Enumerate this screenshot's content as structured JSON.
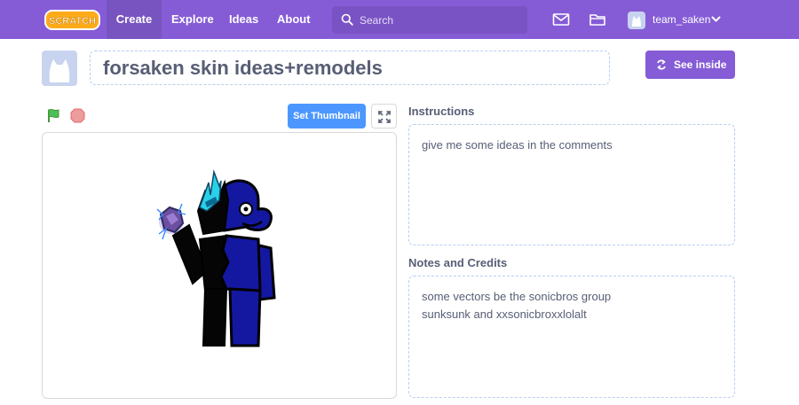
{
  "nav": {
    "logo_text": "SCRATCH",
    "links": {
      "create": "Create",
      "explore": "Explore",
      "ideas": "Ideas",
      "about": "About"
    },
    "search_placeholder": "Search",
    "username": "team_saken",
    "colors": {
      "bar": "#855cd6",
      "active": "#7854c0"
    }
  },
  "project": {
    "title": "forsaken skin ideas+remodels",
    "see_inside_label": "See inside"
  },
  "player": {
    "set_thumbnail_label": "Set Thumbnail"
  },
  "instructions": {
    "heading": "Instructions",
    "text": "give me some ideas in the comments"
  },
  "notes": {
    "heading": "Notes and Credits",
    "lines": [
      "some vectors be the sonicbros group",
      "sunksunk and xxsonicbroxxlolalt"
    ]
  }
}
